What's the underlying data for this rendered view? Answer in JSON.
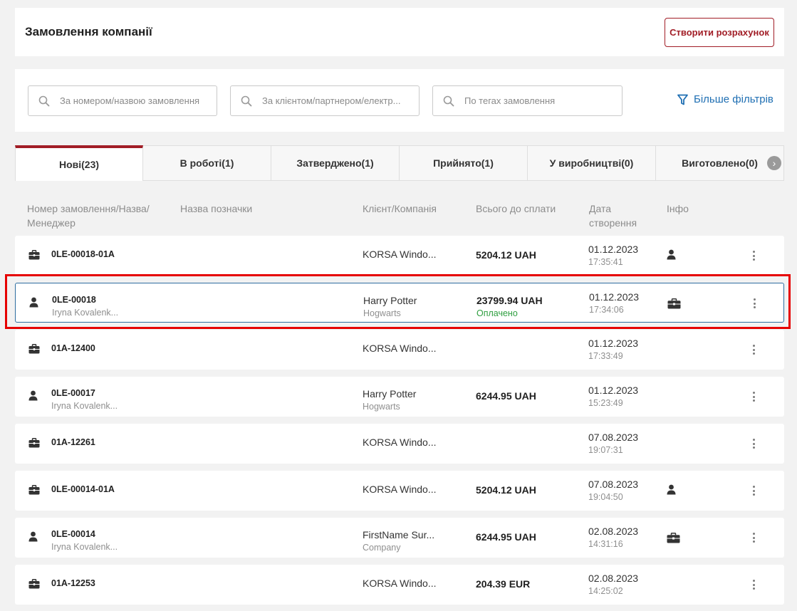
{
  "header": {
    "title": "Замовлення компанії",
    "create_button": "Створити розрахунок"
  },
  "search": {
    "order_placeholder": "За номером/назвою замовлення",
    "client_placeholder": "За клієнтом/партнером/електр...",
    "tags_placeholder": "По тегах замовлення",
    "more_filters": "Більше фільтрів"
  },
  "tabs": [
    {
      "label": "Нові(23)",
      "active": true
    },
    {
      "label": "В роботі(1)"
    },
    {
      "label": "Затверджено(1)"
    },
    {
      "label": "Прийнято(1)"
    },
    {
      "label": "У виробництві(0)"
    },
    {
      "label": "Виготовлено(0)"
    }
  ],
  "columns": {
    "number": "Номер замовлення/Назва/ Менеджер",
    "mark": "Назва позначки",
    "client": "Клієнт/Компанія",
    "total": "Всього до сплати",
    "date": "Дата створення",
    "info": "Інфо"
  },
  "colors": {
    "accent": "#a11d26",
    "link": "#1f6fb3",
    "paid": "#2e9e3f",
    "selection": "#e60000"
  },
  "orders": [
    {
      "type": "briefcase-icon",
      "number": "0LE-00018-01A",
      "manager": "",
      "client": "KORSA Windo...",
      "company": "",
      "amount": "5204.12 UAH",
      "status": "",
      "date": "01.12.2023",
      "time": "17:35:41",
      "info": "person-icon"
    },
    {
      "type": "person-icon",
      "number": "0LE-00018",
      "manager": "Iryna Kovalenk...",
      "client": "Harry Potter",
      "company": "Hogwarts",
      "amount": "23799.94 UAH",
      "status": "Оплачено",
      "date": "01.12.2023",
      "time": "17:34:06",
      "info": "briefcase-icon",
      "selected": true
    },
    {
      "type": "briefcase-icon",
      "number": "01A-12400",
      "manager": "",
      "client": "KORSA Windo...",
      "company": "",
      "amount": "",
      "status": "",
      "date": "01.12.2023",
      "time": "17:33:49",
      "info": ""
    },
    {
      "type": "person-icon",
      "number": "0LE-00017",
      "manager": "Iryna Kovalenk...",
      "client": "Harry Potter",
      "company": "Hogwarts",
      "amount": "6244.95 UAH",
      "status": "",
      "date": "01.12.2023",
      "time": "15:23:49",
      "info": ""
    },
    {
      "type": "briefcase-icon",
      "number": "01A-12261",
      "manager": "",
      "client": "KORSA Windo...",
      "company": "",
      "amount": "",
      "status": "",
      "date": "07.08.2023",
      "time": "19:07:31",
      "info": ""
    },
    {
      "type": "briefcase-icon",
      "number": "0LE-00014-01A",
      "manager": "",
      "client": "KORSA Windo...",
      "company": "",
      "amount": "5204.12 UAH",
      "status": "",
      "date": "07.08.2023",
      "time": "19:04:50",
      "info": "person-icon"
    },
    {
      "type": "person-icon",
      "number": "0LE-00014",
      "manager": "Iryna Kovalenk...",
      "client": "FirstName Sur...",
      "company": "Company",
      "amount": "6244.95 UAH",
      "status": "",
      "date": "02.08.2023",
      "time": "14:31:16",
      "info": "briefcase-icon"
    },
    {
      "type": "briefcase-icon",
      "number": "01A-12253",
      "manager": "",
      "client": "KORSA Windo...",
      "company": "",
      "amount": "204.39 EUR",
      "status": "",
      "date": "02.08.2023",
      "time": "14:25:02",
      "info": ""
    }
  ]
}
